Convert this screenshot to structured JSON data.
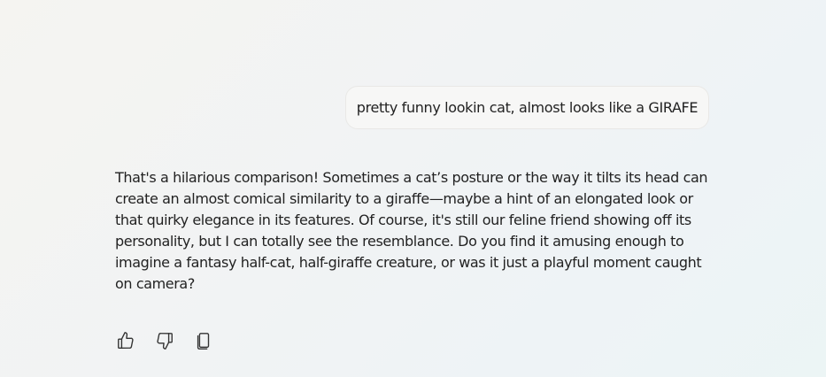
{
  "conversation": {
    "user_message": "pretty funny lookin cat, almost looks like a GIRAFE",
    "assistant_message": "That's a hilarious comparison! Sometimes a cat’s posture or the way it tilts its head can create an almost comical similarity to a giraffe—maybe a hint of an elongated look or that quirky elegance in its features. Of course, it's still our feline friend showing off its personality, but I can totally see the resemblance. Do you find it amusing enough to imagine a fantasy half-cat, half-giraffe creature, or was it just a playful moment caught on camera?"
  },
  "actions": {
    "like_icon": "thumbs-up-icon",
    "dislike_icon": "thumbs-down-icon",
    "copy_icon": "copy-icon"
  }
}
